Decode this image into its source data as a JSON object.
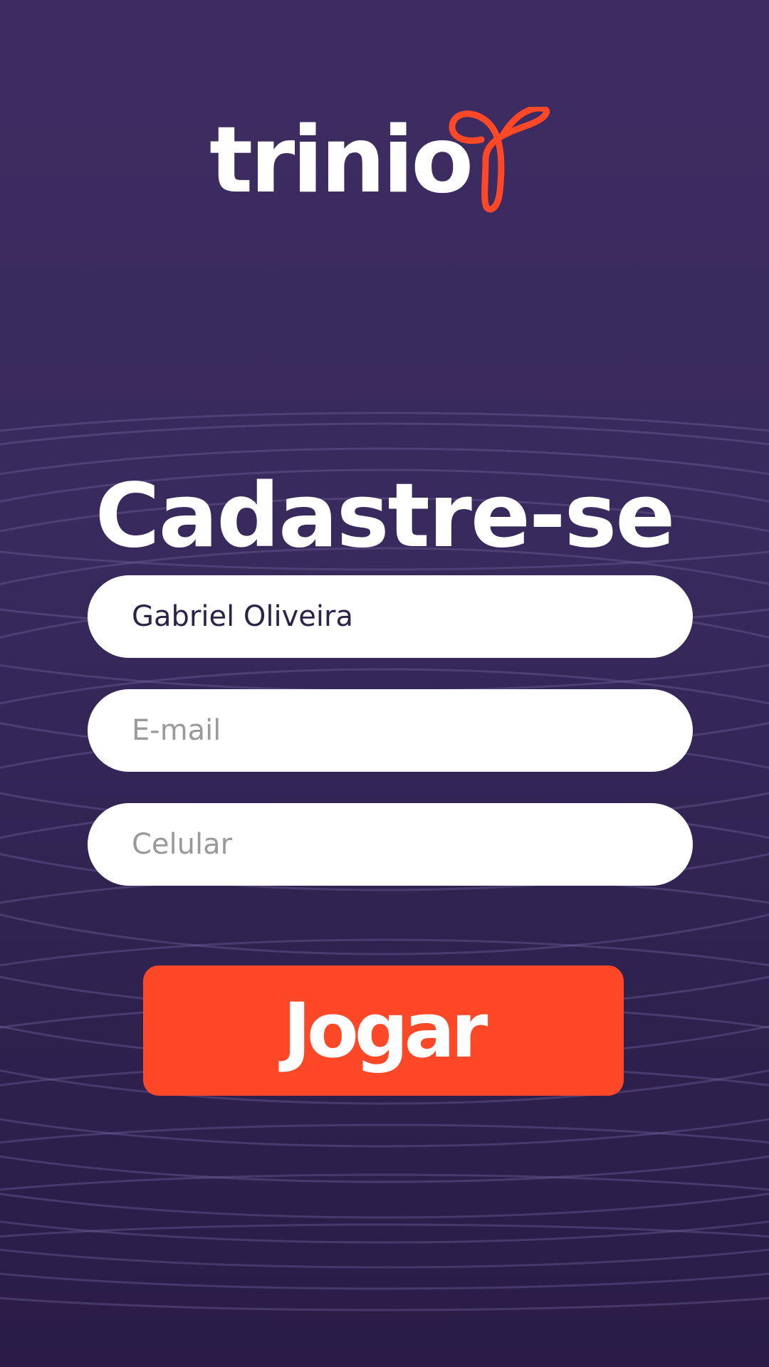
{
  "brand": {
    "name": "trinio",
    "logo_icon": "trinio-ribbon-t-icon"
  },
  "form": {
    "title": "Cadastre-se",
    "name_value": "Gabriel Oliveira",
    "email_placeholder": "E-mail",
    "phone_placeholder": "Celular",
    "submit_label": "Jogar"
  },
  "colors": {
    "background_top": "#3d2c62",
    "background_bottom": "#2a1c47",
    "accent": "#ff4828",
    "field_background": "#ffffff",
    "field_text": "#2d2247",
    "placeholder_text": "#9a9a9a"
  }
}
